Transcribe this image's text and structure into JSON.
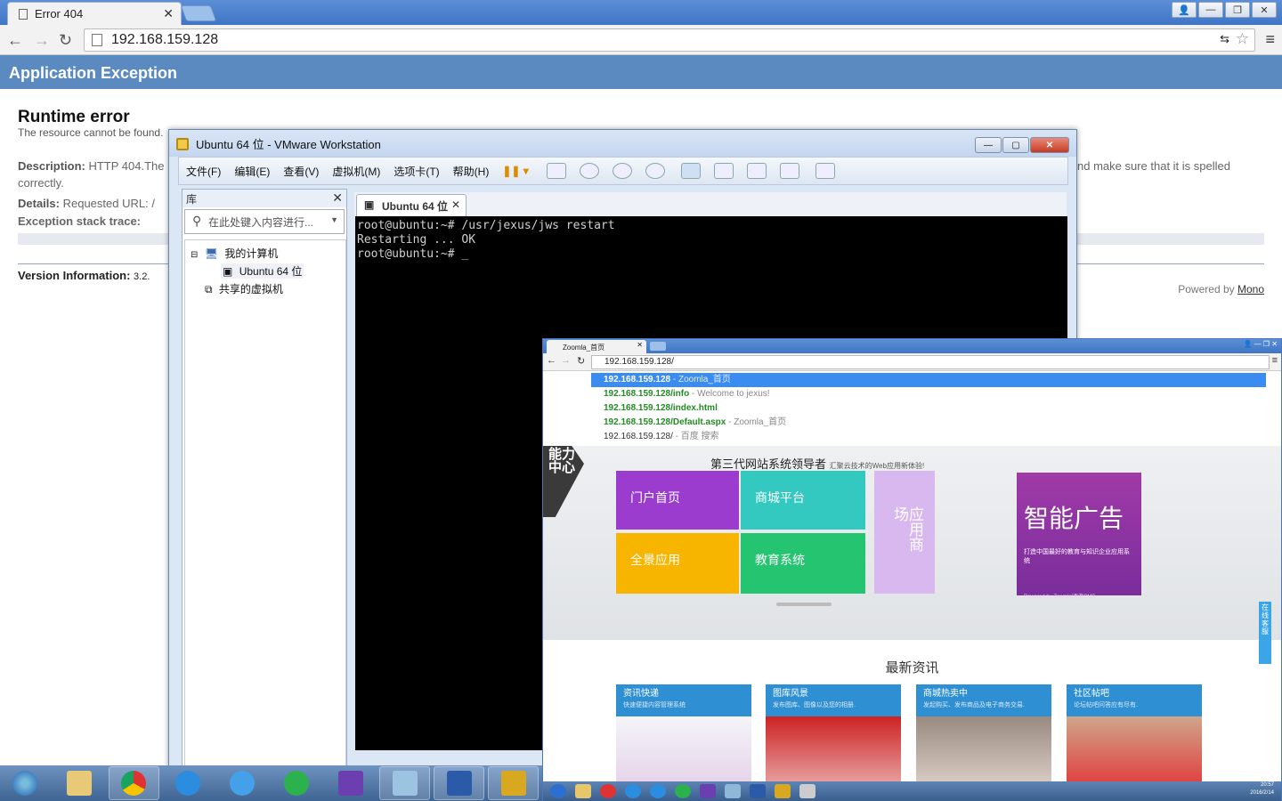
{
  "browser": {
    "tab_title": "Error 404",
    "url": "192.168.159.128"
  },
  "page": {
    "header": "Application Exception",
    "error_title": "Runtime error",
    "error_subtitle": "The resource cannot be found.",
    "description_label": "Description:",
    "description_text": "HTTP 404.The",
    "description_tail": "nd make sure that it is spelled",
    "description_line2": "correctly.",
    "details_label": "Details:",
    "details_text": "Requested URL: /",
    "stack_label": "Exception stack trace:",
    "version_label": "Version Information:",
    "version_text": "3.2.",
    "powered_by": "Powered by",
    "powered_link": "Mono"
  },
  "vmware": {
    "title": "Ubuntu 64 位 - VMware Workstation",
    "menu": [
      "文件(F)",
      "编辑(E)",
      "查看(V)",
      "虚拟机(M)",
      "选项卡(T)",
      "帮助(H)"
    ],
    "library_title": "库",
    "search_placeholder": "在此处键入内容进行...",
    "tree": [
      "我的计算机",
      "Ubuntu 64 位",
      "共享的虚拟机"
    ],
    "vm_tab": "Ubuntu 64 位",
    "console_lines": [
      "root@ubuntu:~# /usr/jexus/jws restart",
      "Restarting ... OK",
      "root@ubuntu:~# _"
    ]
  },
  "inner_browser": {
    "tab_title": "Zoomla_首页",
    "url": "192.168.159.128/",
    "suggestions": [
      {
        "url": "192.168.159.128",
        "desc": " - Zoomla_首页"
      },
      {
        "url": "192.168.159.128/info",
        "desc": " - Welcome to jexus!"
      },
      {
        "url": "192.168.159.128/index.html",
        "desc": ""
      },
      {
        "url": "192.168.159.128/Default.aspx",
        "desc": " - Zoomla_首页"
      },
      {
        "url": "192.168.159.128/",
        "desc": " - 百度 搜索"
      }
    ],
    "side_badge": "能力中心",
    "hero_title": "第三代网站系统领导者",
    "hero_sub": "汇聚云技术的Web应用新体验!",
    "tiles": [
      "门户首页",
      "商城平台",
      "全景应用",
      "教育系统",
      "应用商场"
    ],
    "ad_title": "智能广告",
    "ad_sub": "打造中国最好的教育与知识企业应用系统",
    "ad_powered": "Powered by Zoomla!逐浪CMS",
    "chat_label": "在线客服",
    "news_title": "最新资讯",
    "news": [
      {
        "title": "资讯快递",
        "sub": "快速便捷内容管理系统"
      },
      {
        "title": "图库风景",
        "sub": "发布图库、图像以及您的相册."
      },
      {
        "title": "商城热卖中",
        "sub": "发起购买、发布商品及电子商务交易."
      },
      {
        "title": "社区帖吧",
        "sub": "论坛帖吧问答应有尽有."
      }
    ],
    "clock_time": "20:57",
    "clock_date": "2016/2/14"
  },
  "taskbar": {
    "apps": [
      "start",
      "explorer",
      "chrome",
      "ie",
      "ie-alt",
      "360",
      "visual-studio",
      "notepad",
      "word",
      "vmware"
    ]
  }
}
